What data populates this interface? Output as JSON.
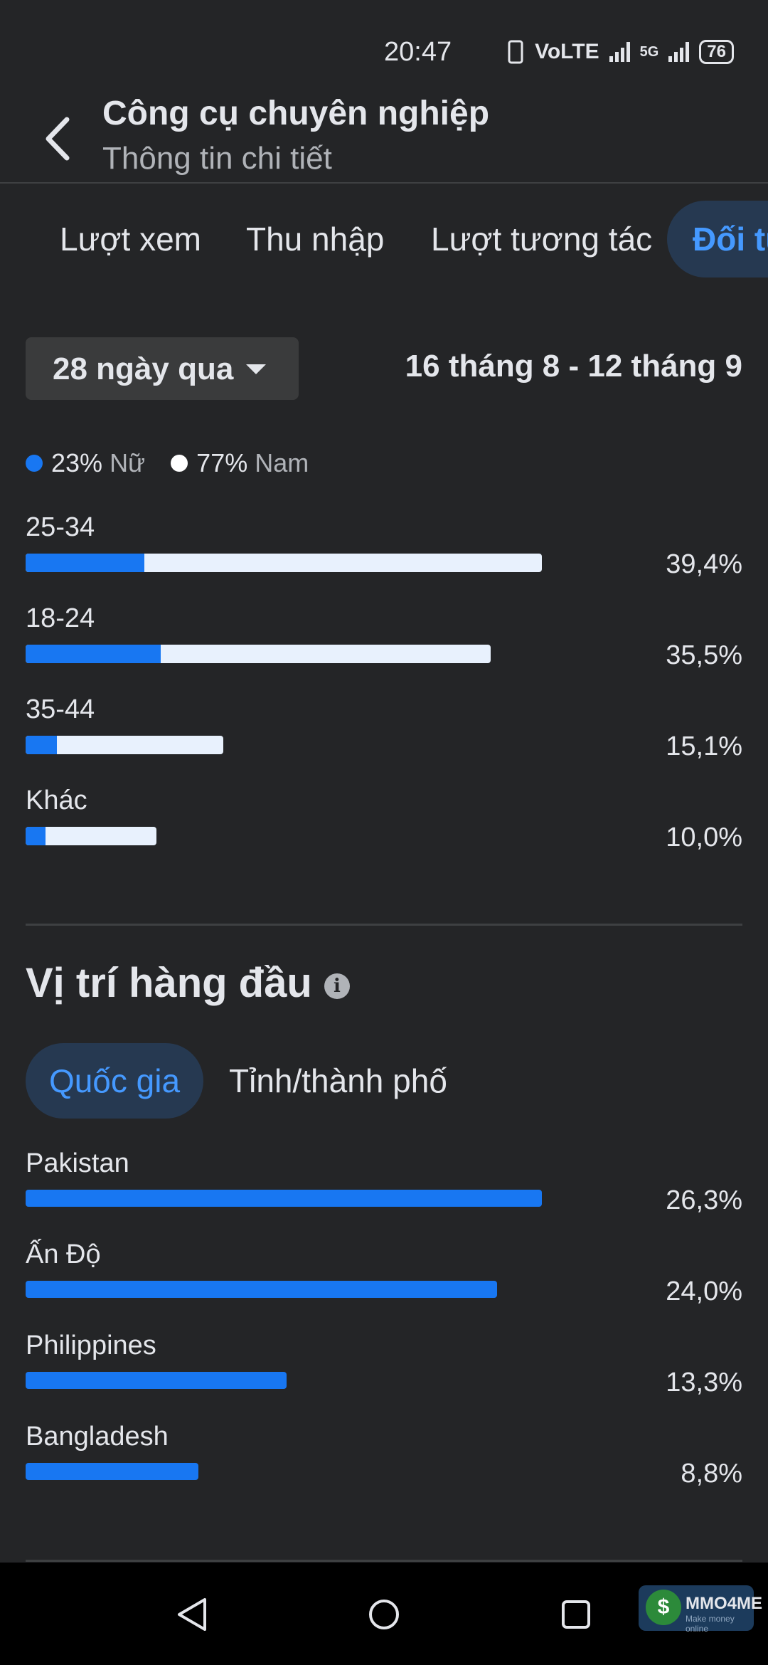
{
  "status_bar": {
    "time": "20:47",
    "network": "VoLTE",
    "network_type": "5G",
    "battery": "76"
  },
  "header": {
    "title": "Công cụ chuyên nghiệp",
    "subtitle": "Thông tin chi tiết",
    "back_icon": "chevron-left-icon"
  },
  "tabs": [
    {
      "label": "Lượt xem",
      "active": false
    },
    {
      "label": "Thu nhập",
      "active": false
    },
    {
      "label": "Lượt tương tác",
      "active": false
    },
    {
      "label": "Đối tu",
      "active": true
    }
  ],
  "filter": {
    "range_label": "28 ngày qua",
    "date_range": "16 tháng 8 - 12 tháng 9"
  },
  "gender": {
    "female_pct": "23%",
    "female_label": "Nữ",
    "female_color": "#1877f2",
    "male_pct": "77%",
    "male_label": "Nam",
    "male_color": "#e8f1fd"
  },
  "age_groups": [
    {
      "label": "25-34",
      "value": "39,4%",
      "total": 39.4,
      "female_share": 0.23
    },
    {
      "label": "18-24",
      "value": "35,5%",
      "total": 35.5,
      "female_share": 0.29
    },
    {
      "label": "35-44",
      "value": "15,1%",
      "total": 15.1,
      "female_share": 0.16
    },
    {
      "label": "Khác",
      "value": "10,0%",
      "total": 10.0,
      "female_share": 0.15
    }
  ],
  "locations": {
    "title": "Vị trí hàng đầu",
    "tabs": {
      "country": "Quốc gia",
      "city": "Tỉnh/thành phố"
    },
    "items": [
      {
        "label": "Pakistan",
        "value": "26,3%",
        "total": 26.3
      },
      {
        "label": "Ấn Độ",
        "value": "24,0%",
        "total": 24.0
      },
      {
        "label": "Philippines",
        "value": "13,3%",
        "total": 13.3
      },
      {
        "label": "Bangladesh",
        "value": "8,8%",
        "total": 8.8
      }
    ]
  },
  "watermark": {
    "brand": "MMO4ME",
    "tagline": "Make money online"
  },
  "colors": {
    "accent": "#1877f2",
    "active_tab_bg": "#263951",
    "active_tab_text": "#4599ff",
    "background": "#242527"
  }
}
